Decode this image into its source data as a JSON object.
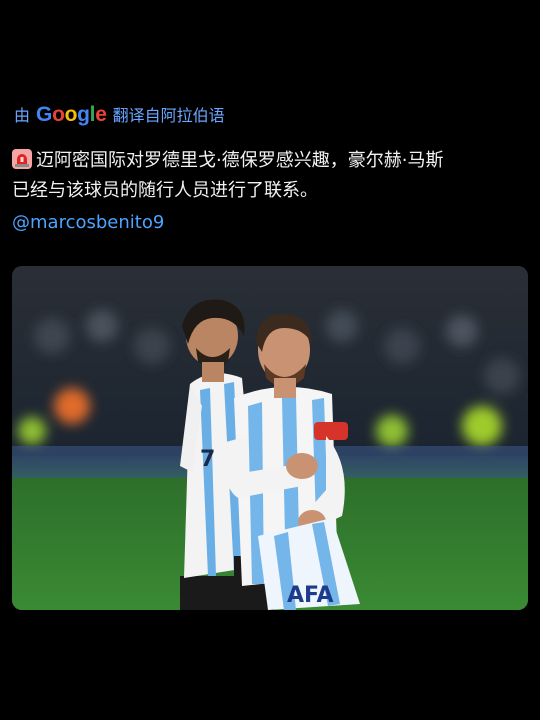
{
  "translation": {
    "prefix": "由",
    "brand_letters": [
      "G",
      "o",
      "o",
      "g",
      "l",
      "e"
    ],
    "suffix": "翻译自阿拉伯语"
  },
  "tweet": {
    "emoji": "siren-emoji",
    "text_line1": "迈阿密国际对罗德里戈·德保罗感兴趣，豪尔赫·马斯",
    "text_line2": "已经与该球员的随行人员进行了联系。",
    "mention": "@marcosbenito9"
  },
  "photo": {
    "subject": "two-argentina-players",
    "jersey_number": "7",
    "badge_text": "AFA"
  },
  "colors": {
    "link": "#4da3ff",
    "translate_text": "#6aa6ff",
    "background": "#000000"
  }
}
